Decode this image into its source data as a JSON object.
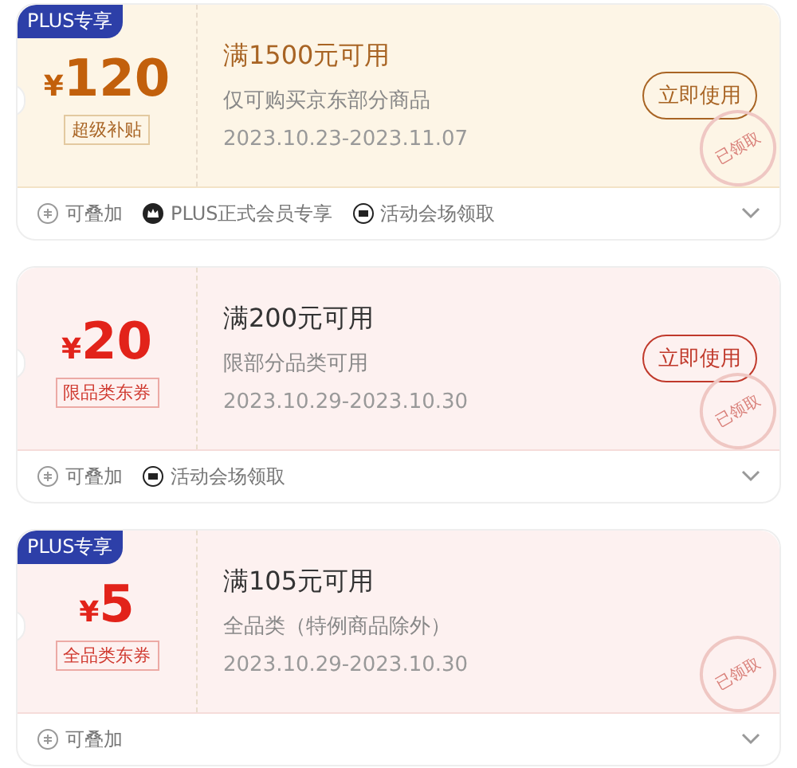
{
  "coupons": [
    {
      "kind": "gold",
      "badge": "PLUS专享",
      "currency": "¥",
      "amount": "120",
      "label": "超级补贴",
      "title": "满1500元可用",
      "scope": "仅可购买京东部分商品",
      "dates": "2023.10.23-2023.11.07",
      "button": "立即使用",
      "stamp": "已领取",
      "tags": [
        {
          "kind": "stack",
          "text": "可叠加"
        },
        {
          "kind": "crown",
          "text": "PLUS正式会员专享"
        },
        {
          "kind": "ticket",
          "text": "活动会场领取"
        }
      ]
    },
    {
      "kind": "red",
      "currency": "¥",
      "amount": "20",
      "label": "限品类东券",
      "title": "满200元可用",
      "scope": "限部分品类可用",
      "dates": "2023.10.29-2023.10.30",
      "button": "立即使用",
      "stamp": "已领取",
      "tags": [
        {
          "kind": "stack",
          "text": "可叠加"
        },
        {
          "kind": "ticket",
          "text": "活动会场领取"
        }
      ]
    },
    {
      "kind": "red",
      "badge": "PLUS专享",
      "currency": "¥",
      "amount": "5",
      "label": "全品类东券",
      "title": "满105元可用",
      "scope": "全品类（特例商品除外）",
      "dates": "2023.10.29-2023.10.30",
      "stamp": "已领取",
      "tags": [
        {
          "kind": "stack",
          "text": "可叠加"
        }
      ]
    }
  ]
}
